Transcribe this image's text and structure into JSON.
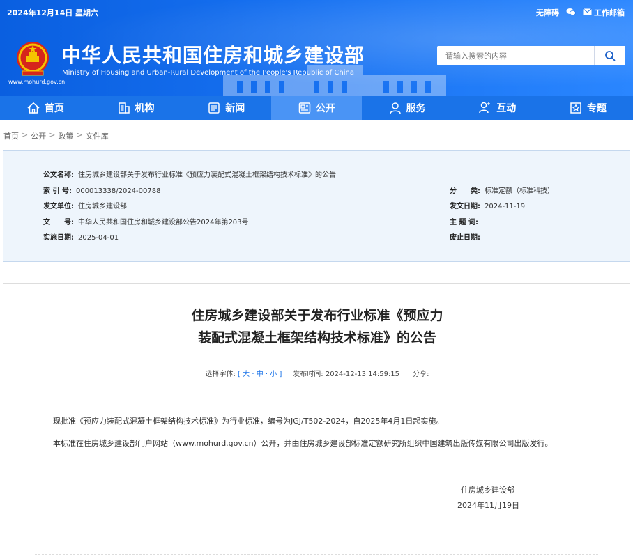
{
  "header": {
    "date": "2024年12月14日 星期六",
    "top_links": {
      "accessibility": "无障碍",
      "wechat_icon": "wechat-icon",
      "email_icon": "mail-icon",
      "email": "工作邮箱"
    },
    "site_url": "www.mohurd.gov.cn",
    "title_cn": "中华人民共和国住房和城乡建设部",
    "title_en": "Ministry of Housing and Urban-Rural Development of the People's Republic of China",
    "search": {
      "placeholder": "请输入搜索的内容",
      "icon": "search-icon"
    }
  },
  "nav": {
    "items": [
      {
        "label": "首页",
        "icon": "home-icon"
      },
      {
        "label": "机构",
        "icon": "building-icon"
      },
      {
        "label": "新闻",
        "icon": "news-icon"
      },
      {
        "label": "公开",
        "icon": "disclosure-icon",
        "active": true
      },
      {
        "label": "服务",
        "icon": "service-icon"
      },
      {
        "label": "互动",
        "icon": "interact-icon"
      },
      {
        "label": "专题",
        "icon": "topic-icon"
      }
    ]
  },
  "breadcrumb": [
    "首页",
    "公开",
    "政策",
    "文件库"
  ],
  "info": {
    "title_label": "公文名称:",
    "title_value": "住房城乡建设部关于发布行业标准《预应力装配式混凝土框架结构技术标准》的公告",
    "index_label": "索 引 号:",
    "index_value": "000013338/2024-00788",
    "category_label": "分　　类:",
    "category_value": "标准定额（标准科技）",
    "issuer_label": "发文单位:",
    "issuer_value": "住房城乡建设部",
    "date_label": "发文日期:",
    "date_value": "2024-11-19",
    "docno_label": "文　　号:",
    "docno_value": "中华人民共和国住房和城乡建设部公告2024年第203号",
    "keyword_label": "主 题 词:",
    "keyword_value": "",
    "impl_label": "实施日期:",
    "impl_value": "2025-04-01",
    "abolish_label": "废止日期:",
    "abolish_value": ""
  },
  "article": {
    "title_line1": "住房城乡建设部关于发布行业标准《预应力",
    "title_line2": "装配式混凝土框架结构技术标准》的公告",
    "font_label": "选择字体:",
    "font_open": "[",
    "font_large": "大",
    "font_medium": "中",
    "font_small": "小",
    "font_close": "]",
    "font_sep": "·",
    "publish_label": "发布时间:",
    "publish_time": "2024-12-13 14:59:15",
    "share_label": "分享:",
    "para1": "现批准《预应力装配式混凝土框架结构技术标准》为行业标准，编号为JGJ/T502-2024，自2025年4月1日起实施。",
    "para2": "本标准在住房城乡建设部门户网站（www.mohurd.gov.cn）公开，并由住房城乡建设部标准定额研究所组织中国建筑出版传媒有限公司出版发行。",
    "sign_org": "住房城乡建设部",
    "sign_date": "2024年11月19日"
  }
}
